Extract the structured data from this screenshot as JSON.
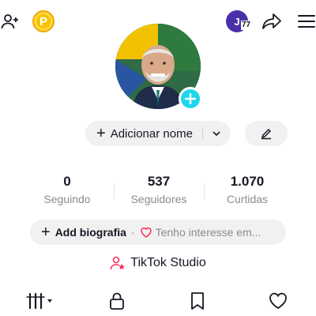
{
  "topbar": {
    "coin_label": "P",
    "user_initial": "J",
    "user_badge": "77",
    "icons": [
      "add-user-icon",
      "coin-icon",
      "share-icon",
      "menu-icon"
    ]
  },
  "profile": {
    "name_button_label": "Adicionar nome",
    "colors": {
      "accent": "#20d5ec",
      "pill_bg": "#f1f1f2"
    }
  },
  "stats": [
    {
      "value": "0",
      "label": "Seguindo"
    },
    {
      "value": "537",
      "label": "Seguidores"
    },
    {
      "value": "1.070",
      "label": "Curtidas"
    }
  ],
  "bio": {
    "add_label": "Add biografia",
    "separator": "·",
    "interest_label": "Tenho interesse em..."
  },
  "studio": {
    "label": "TikTok Studio"
  },
  "tabs": [
    "videos-grid-icon",
    "lock-icon",
    "bookmark-icon",
    "heart-icon"
  ]
}
